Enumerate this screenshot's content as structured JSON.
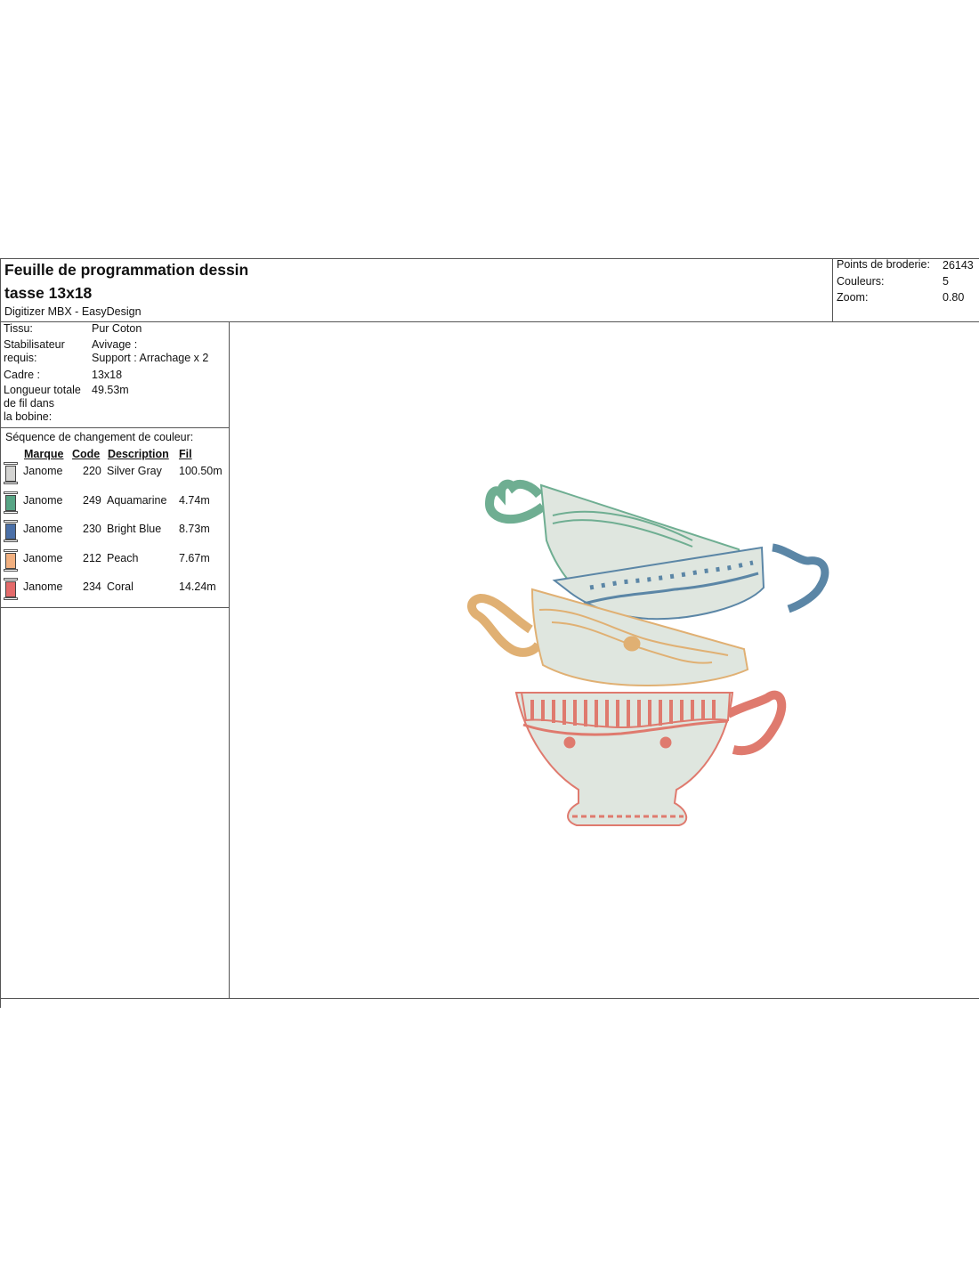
{
  "header": {
    "title_line1": "Feuille de programmation dessin",
    "title_line2": "tasse 13x18",
    "software": "Digitizer MBX - EasyDesign"
  },
  "stats": {
    "stitches_label": "Points de broderie:",
    "stitches_value": "26143",
    "colors_label": "Couleurs:",
    "colors_value": "5",
    "zoom_label": "Zoom:",
    "zoom_value": "0.80"
  },
  "info": {
    "fabric_label": "Tissu:",
    "fabric_value": "Pur Coton",
    "stabilizer_label_1": "Stabilisateur",
    "stabilizer_label_2": "requis:",
    "stabilizer_value_1": "Avivage :",
    "stabilizer_value_2": "Support : Arrachage x 2",
    "hoop_label": "Cadre :",
    "hoop_value": "13x18",
    "thread_label_1": "Longueur totale",
    "thread_label_2": "de fil dans",
    "thread_label_3": "la bobine:",
    "thread_value": "49.53m"
  },
  "sequence": {
    "title": "Séquence de changement de couleur:",
    "headers": {
      "brand": "Marque",
      "code": "Code",
      "description": "Description",
      "thread": "Fil"
    },
    "rows": [
      {
        "brand": "Janome",
        "code": "220",
        "description": "Silver Gray",
        "thread": "100.50m",
        "color": "#d4d4d2"
      },
      {
        "brand": "Janome",
        "code": "249",
        "description": "Aquamarine",
        "thread": "4.74m",
        "color": "#57a585"
      },
      {
        "brand": "Janome",
        "code": "230",
        "description": "Bright Blue",
        "thread": "8.73m",
        "color": "#4b70a8"
      },
      {
        "brand": "Janome",
        "code": "212",
        "description": "Peach",
        "thread": "7.67m",
        "color": "#f2b080"
      },
      {
        "brand": "Janome",
        "code": "234",
        "description": "Coral",
        "thread": "14.24m",
        "color": "#e46a6a"
      }
    ]
  },
  "design_colors": {
    "fill": "#dfe6df",
    "aquamarine": "#6fae92",
    "blue": "#5b86a6",
    "peach": "#e0b073",
    "coral": "#df7a6e"
  }
}
